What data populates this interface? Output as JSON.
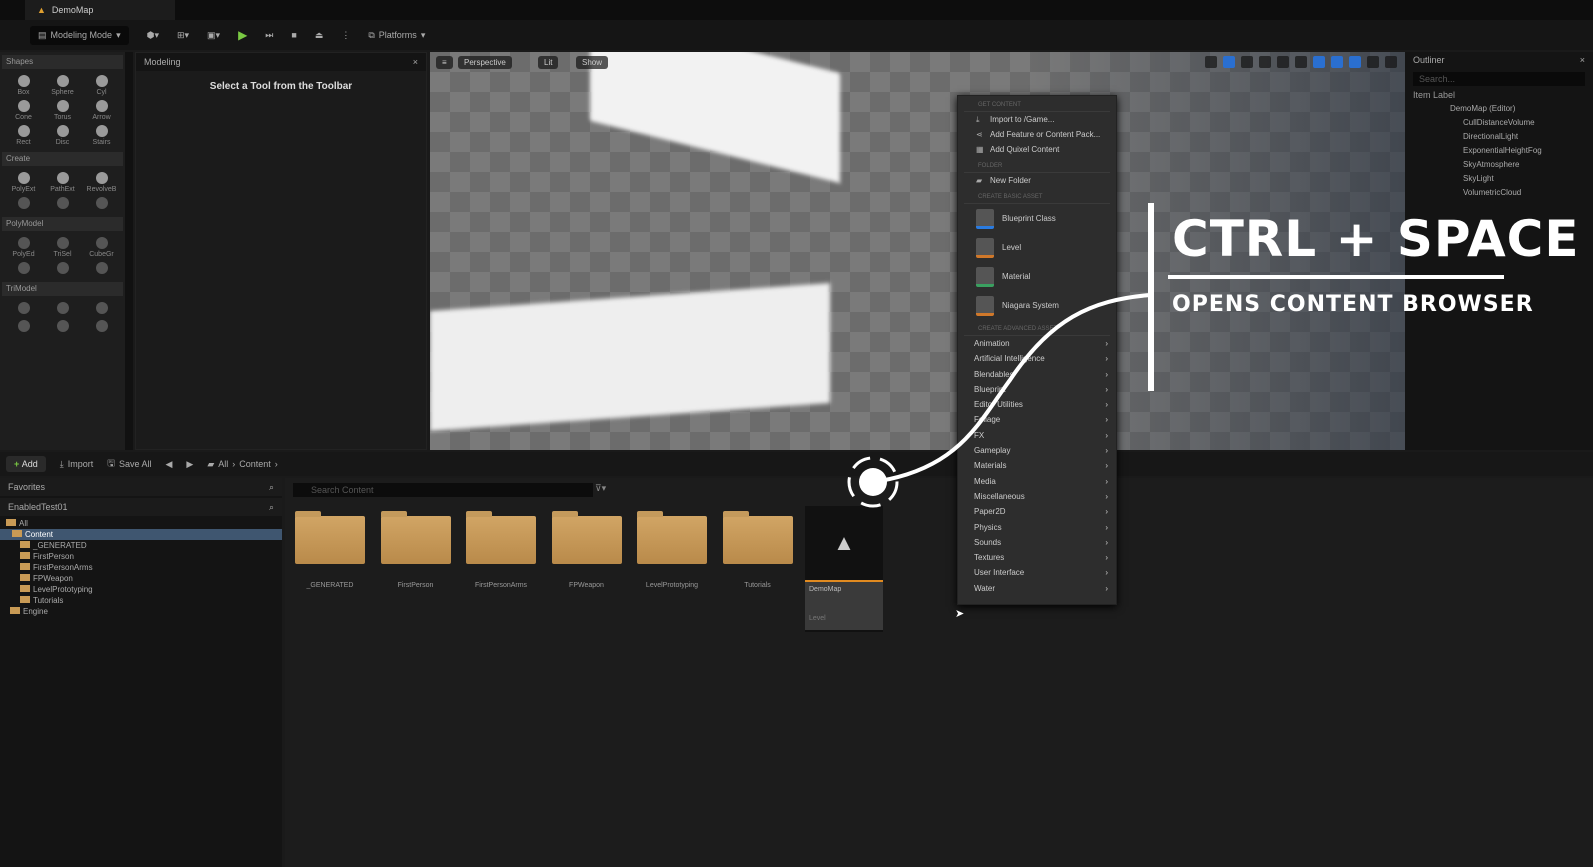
{
  "titlebar": {
    "tab": "DemoMap"
  },
  "toolbar": {
    "mode": "Modeling Mode",
    "platforms": "Platforms"
  },
  "palette": {
    "sections": [
      {
        "title": "Shapes",
        "tools": [
          "Box",
          "Sphere",
          "Cyl",
          "Cone",
          "Torus",
          "Arrow",
          "Rect",
          "Disc",
          "Stairs"
        ]
      },
      {
        "title": "Create",
        "tools": [
          "PolyExt",
          "PathExt",
          "RevolveB",
          "",
          "",
          ""
        ]
      },
      {
        "title": "PolyModel",
        "tools": [
          "PolyEd",
          "TriSel",
          "CubeGr",
          "",
          "",
          ""
        ]
      },
      {
        "title": "TriModel",
        "tools": [
          "",
          "",
          "",
          "",
          "",
          ""
        ]
      }
    ]
  },
  "modeling": {
    "tab": "Modeling",
    "message": "Select a Tool from the Toolbar"
  },
  "viewport": {
    "perspective": "Perspective",
    "lit": "Lit",
    "show": "Show"
  },
  "outliner": {
    "tab": "Outliner",
    "search_placeholder": "Search...",
    "column": "Item Label",
    "root": "DemoMap (Editor)",
    "items": [
      "CullDistanceVolume",
      "DirectionalLight",
      "ExponentialHeightFog",
      "SkyAtmosphere",
      "SkyLight",
      "VolumetricCloud"
    ]
  },
  "content_bar": {
    "add": "Add",
    "import": "Import",
    "save_all": "Save All",
    "crumb_all": "All",
    "crumb_content": "Content"
  },
  "tree": {
    "favorites": "Favorites",
    "project": "EnabledTest01",
    "all": "All",
    "content": "Content",
    "children": [
      "_GENERATED",
      "FirstPerson",
      "FirstPersonArms",
      "FPWeapon",
      "LevelPrototyping",
      "Tutorials"
    ],
    "engine": "Engine"
  },
  "assets": {
    "search_placeholder": "Search Content",
    "folders": [
      "_GENERATED",
      "FirstPerson",
      "FirstPersonArms",
      "FPWeapon",
      "LevelPrototyping",
      "Tutorials"
    ],
    "map": {
      "name": "DemoMap",
      "type": "Level"
    }
  },
  "menu": {
    "header1": "GET CONTENT",
    "items": [
      "Import to /Game...",
      "Add Feature or Content Pack...",
      "Add Quixel Content"
    ],
    "header2": "FOLDER",
    "new_folder": "New Folder",
    "header3": "CREATE BASIC ASSET",
    "basic": [
      "Blueprint Class",
      "Level",
      "Material",
      "Niagara System"
    ],
    "header4": "CREATE ADVANCED ASSET",
    "categories": [
      "Animation",
      "Artificial Intelligence",
      "Blendables",
      "Blueprint",
      "Editor Utilities",
      "Foliage",
      "FX",
      "Gameplay",
      "Materials",
      "Media",
      "Miscellaneous",
      "Paper2D",
      "Physics",
      "Sounds",
      "Textures",
      "User Interface",
      "Water"
    ]
  },
  "overlay": {
    "title": "CTRL + SPACE",
    "subtitle": "OPENS CONTENT BROWSER"
  }
}
